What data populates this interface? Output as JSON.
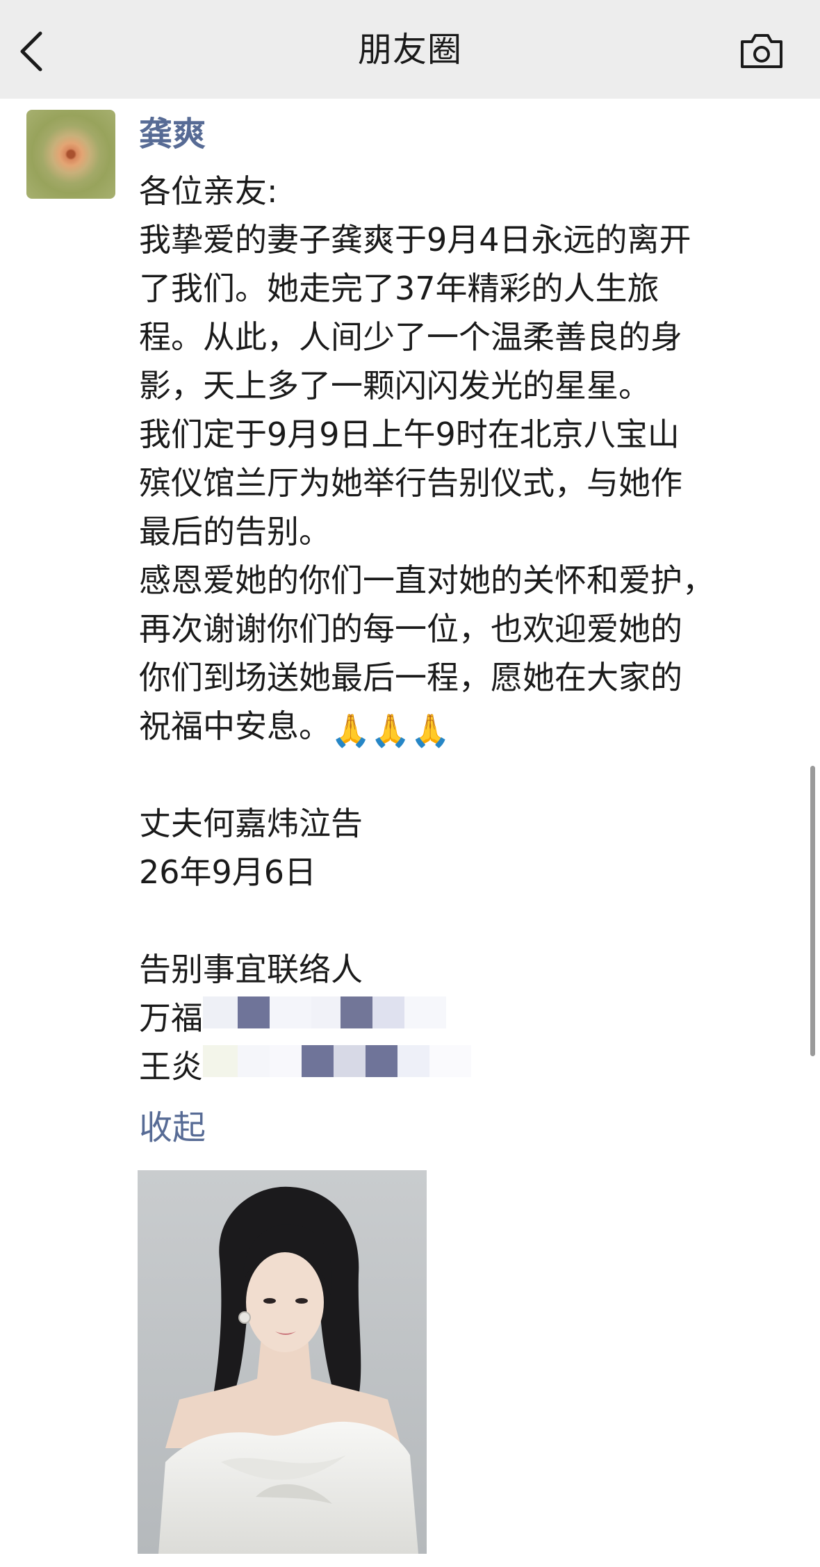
{
  "navbar": {
    "title": "朋友圈",
    "back_icon": "chevron-left-icon",
    "camera_icon": "camera-icon"
  },
  "post": {
    "author": "龚爽",
    "lines": [
      "各位亲友:",
      "我挚爱的妻子龚爽于9月4日永远的离开",
      "了我们。她走完了37年精彩的人生旅",
      "程。从此，人间少了一个温柔善良的身",
      "影，天上多了一颗闪闪发光的星星。",
      "我们定于9月9日上午9时在北京八宝山",
      "殡仪馆兰厅为她举行告别仪式，与她作",
      "最后的告别。",
      "感恩爱她的你们一直对她的关怀和爱护，",
      "再次谢谢你们的每一位，也欢迎爱她的",
      "你们到场送她最后一程，愿她在大家的",
      "祝福中安息。"
    ],
    "emoji": "🙏🙏🙏",
    "signature": "丈夫何嘉炜泣告",
    "date": "26年9月6日",
    "contact_title": "告别事宜联络人",
    "contacts": [
      "万福",
      "王炎"
    ],
    "collapse_label": "收起"
  },
  "colors": {
    "navbar_bg": "#ededed",
    "link": "#576b95",
    "text": "#1a1a1a"
  }
}
